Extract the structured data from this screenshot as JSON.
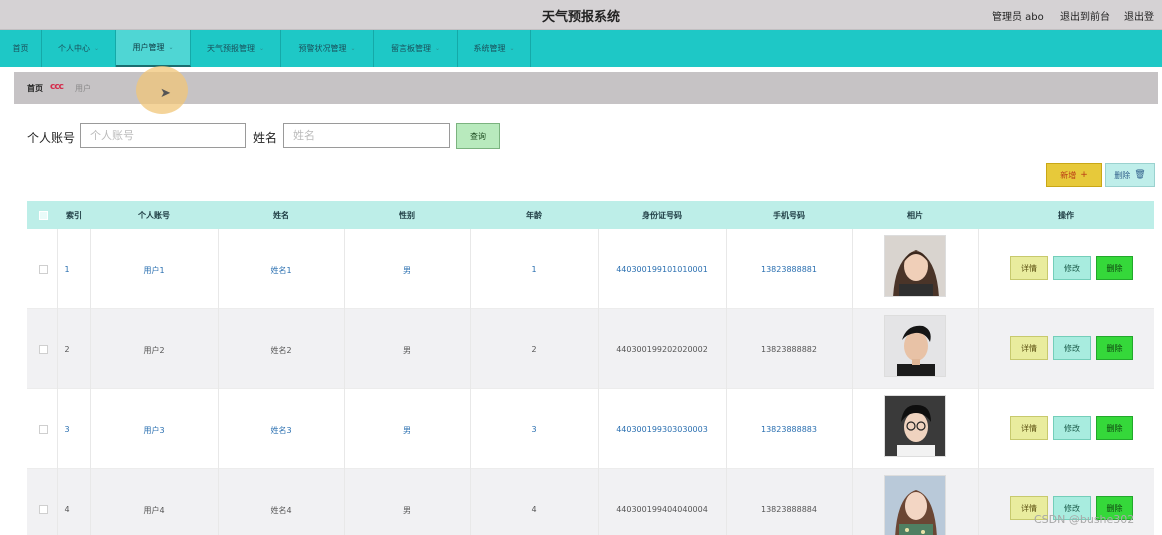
{
  "header": {
    "title": "天气预报系统",
    "admin": "管理员 abo",
    "front": "退出到前台",
    "logout": "退出登"
  },
  "nav": [
    {
      "label": "首页",
      "arrow": ""
    },
    {
      "label": "个人中心",
      "arrow": "⌄"
    },
    {
      "label": "用户管理",
      "arrow": "⌄"
    },
    {
      "label": "天气预报管理",
      "arrow": "⌄"
    },
    {
      "label": "预警状况管理",
      "arrow": "⌄"
    },
    {
      "label": "留言板管理",
      "arrow": "⌄"
    },
    {
      "label": "系统管理",
      "arrow": "⌄"
    }
  ],
  "breadcrumb": {
    "home": "首页",
    "separator": "ccc",
    "current": "用户"
  },
  "search": {
    "account_label": "个人账号",
    "account_placeholder": "个人账号",
    "name_label": "姓名",
    "name_placeholder": "姓名",
    "query_label": "查询"
  },
  "actions": {
    "add_label": "新增",
    "add_icon": "+",
    "delete_label": "删除",
    "delete_icon": "trash-icon"
  },
  "table": {
    "columns": [
      "索引",
      "个人账号",
      "姓名",
      "性别",
      "年龄",
      "身份证号码",
      "手机号码",
      "相片",
      "操作"
    ],
    "rows": [
      {
        "index": "1",
        "account": "用户1",
        "name": "姓名1",
        "gender": "男",
        "age": "1",
        "id_card": "440300199101010001",
        "phone": "13823888881"
      },
      {
        "index": "2",
        "account": "用户2",
        "name": "姓名2",
        "gender": "男",
        "age": "2",
        "id_card": "440300199202020002",
        "phone": "13823888882"
      },
      {
        "index": "3",
        "account": "用户3",
        "name": "姓名3",
        "gender": "男",
        "age": "3",
        "id_card": "440300199303030003",
        "phone": "13823888883"
      },
      {
        "index": "4",
        "account": "用户4",
        "name": "姓名4",
        "gender": "男",
        "age": "4",
        "id_card": "440300199404040004",
        "phone": "13823888884"
      }
    ],
    "row_actions": {
      "detail": "详情",
      "edit": "修改",
      "remove": "删除"
    }
  },
  "watermark": "CSDN @bushe302",
  "colors": {
    "nav": "#1ec8c6",
    "table_header": "#bdeee8",
    "add_button": "#e7c93a",
    "remove_button": "#35d83a"
  }
}
